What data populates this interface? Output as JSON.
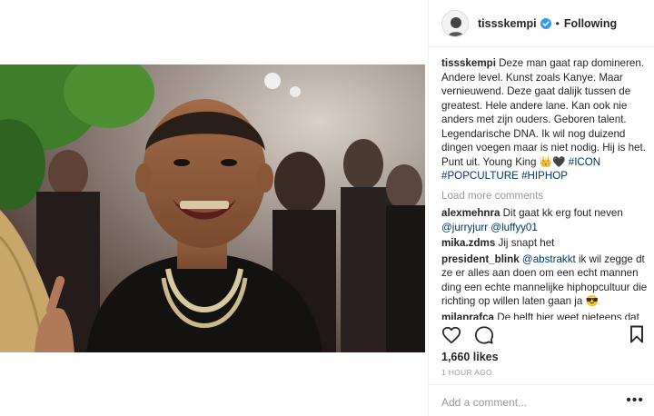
{
  "post": {
    "username": "tissskempi",
    "follow_status": "Following",
    "separator": "•",
    "verified": true
  },
  "caption": {
    "username": "tissskempi",
    "text": " Deze man gaat rap domineren. Andere level. Kunst zoals Kanye. Maar vernieuwend. Deze gaat dalijk tussen de greatest. Hele andere lane. Kan ook nie anders met zijn ouders. Geboren talent. Legendarische DNA. Ik wil nog duizend dingen voegen maar is niet nodig. Hij is het. Punt uit. Young King 👑🖤 ",
    "hashtags": [
      "#ICON",
      "#POPCULTURE",
      "#HIPHOP"
    ]
  },
  "load_more": "Load more comments",
  "comments": [
    {
      "user": "alexmehnra",
      "text": " Dit gaat kk erg fout neven ",
      "mentions": [
        "@jurryjurr",
        "@luffyy01"
      ]
    },
    {
      "user": "mika.zdms",
      "text": " Jij snapt het",
      "mentions": []
    },
    {
      "user": "president_blink",
      "mention_first": "@abstrakkt",
      "text": " ik wil zegge dt ze er alles aan doen om een echt mannen ding een echte mannelijke hiphopcultuur die richting op willen laten gaan ja 😎"
    },
    {
      "user": "milanrafca",
      "text": " De helft hier weet nieteens dat die rapt😂"
    }
  ],
  "likes": "1,660 likes",
  "time_ago": "1 HOUR AGO",
  "add_comment_placeholder": "Add a comment...",
  "more_options": "•••",
  "icons": {
    "like": "heart-icon",
    "comment": "comment-icon",
    "save": "bookmark-icon",
    "verified": "verified-badge-icon"
  },
  "colors": {
    "text": "#262626",
    "muted": "#999999",
    "link": "#003569",
    "verified": "#3897f0",
    "border": "#efefef"
  }
}
